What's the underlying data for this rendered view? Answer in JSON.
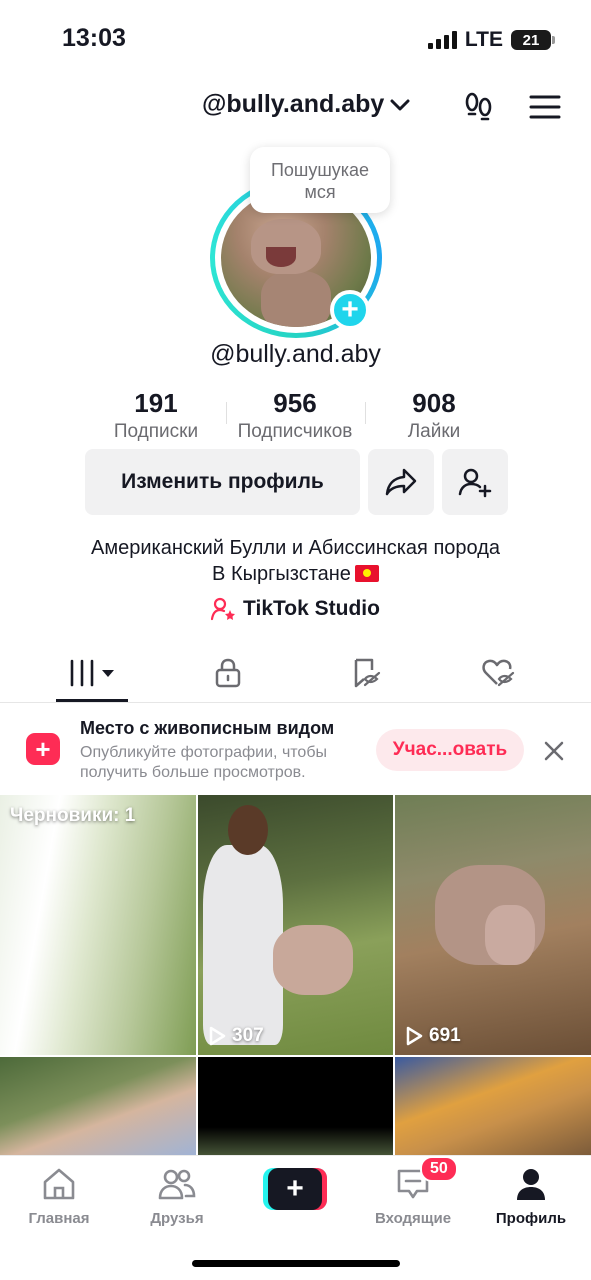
{
  "status_bar": {
    "time": "13:03",
    "network": "LTE",
    "battery": "21"
  },
  "header": {
    "username": "@bully.and.aby"
  },
  "profile": {
    "tooltip": "Пошушукаемся",
    "tooltip_line1": "Пошушукае",
    "tooltip_line2": "мся",
    "handle": "@bully.and.aby"
  },
  "stats": [
    {
      "value": "191",
      "label": "Подписки"
    },
    {
      "value": "956",
      "label": "Подписчиков"
    },
    {
      "value": "908",
      "label": "Лайки"
    }
  ],
  "buttons": {
    "edit_profile": "Изменить профиль"
  },
  "bio": {
    "line1": "Американский Булли и Абиссинская порода",
    "line2": "В Кыргызстане"
  },
  "studio": {
    "label": "TikTok Studio"
  },
  "promo": {
    "title": "Место с живописным видом",
    "description": "Опубликуйте фотографии, чтобы получить больше просмотров.",
    "button": "Учас...овать"
  },
  "grid": {
    "drafts_label": "Черновики: 1",
    "videos": [
      {
        "views": "307"
      },
      {
        "views": "691"
      }
    ]
  },
  "bottom_nav": {
    "items": [
      {
        "label": "Главная"
      },
      {
        "label": "Друзья"
      },
      {
        "label": "Входящие",
        "badge": "50"
      },
      {
        "label": "Профиль"
      }
    ]
  },
  "colors": {
    "accent": "#fe2c55",
    "cyan": "#25f4ee",
    "ring": "#20d5ec"
  }
}
